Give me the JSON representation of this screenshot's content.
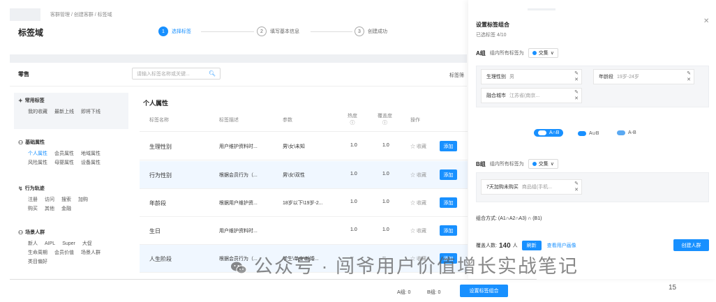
{
  "breadcrumb": "客群管理 / 创建客群 / 标签域",
  "page_title": "标签域",
  "steps": [
    {
      "num": "1",
      "label": "选择标签"
    },
    {
      "num": "2",
      "label": "填写基本信息"
    },
    {
      "num": "3",
      "label": "创建成功"
    }
  ],
  "section_label": "零售",
  "search": {
    "placeholder": "请输入标签名称或关键..."
  },
  "top_right_label": "标签筛",
  "sidebar": {
    "common": {
      "title": "常用标签",
      "items": [
        "我的收藏",
        "最新上线",
        "即将下线"
      ]
    },
    "basic": {
      "title": "基础属性",
      "row1": [
        "个人属性",
        "会员属性",
        "地域属性"
      ],
      "row2": [
        "风险属性",
        "母婴属性",
        "设备属性"
      ]
    },
    "behavior": {
      "title": "行为轨迹",
      "row1": [
        "注册",
        "访问",
        "搜索",
        "加购"
      ],
      "row2": [
        "购买",
        "其他",
        "金融"
      ]
    },
    "scene": {
      "title": "场景人群",
      "row1": [
        "新人",
        "AIPL",
        "Super",
        "大促"
      ],
      "row2": [
        "生命周期",
        "会员价值",
        "场景人群"
      ],
      "row3": [
        "类目偏好"
      ]
    }
  },
  "table": {
    "title": "个人属性",
    "headers": [
      "标签名称",
      "标签描述",
      "参数",
      "热度",
      "覆盖度",
      "操作"
    ],
    "rows": [
      {
        "name": "生理性别",
        "desc": "用户维护资料时...",
        "param": "男\\女\\未知",
        "heat": "1.0",
        "cover": "1.0",
        "fav": "☆ 收藏",
        "add": "添加"
      },
      {
        "name": "行为性别",
        "desc": "根据会员行为（...",
        "param": "男\\女\\双性",
        "heat": "1.0",
        "cover": "1.0",
        "fav": "☆ 收藏",
        "add": "添加"
      },
      {
        "name": "年龄段",
        "desc": "根据用户维护资...",
        "param": "18岁以下\\19岁-2...",
        "heat": "1.0",
        "cover": "1.0",
        "fav": "☆ 收藏",
        "add": "添加"
      },
      {
        "name": "生日",
        "desc": "用户维护资料时...",
        "param": "",
        "heat": "1.0",
        "cover": "1.0",
        "fav": "☆ 收藏",
        "add": "添加"
      },
      {
        "name": "人生阶段",
        "desc": "根据会员行为（...",
        "param": "学生\\单身\\新婚...",
        "heat": "--",
        "cover": "--",
        "fav": "☆ 收藏",
        "add": "添加"
      }
    ]
  },
  "bottom": {
    "count_a": "A组: 0",
    "count_b": "B组: 0",
    "set_combo": "设置标签组合"
  },
  "drawer": {
    "title": "设置标签组合",
    "subtitle": "已选标签 4/10",
    "group_a": {
      "label": "A组",
      "hint": "组内所有标签为",
      "op": "交集",
      "tags": [
        {
          "name": "生理性别",
          "value": "男"
        },
        {
          "name": "年龄段",
          "value": "19岁-24岁"
        },
        {
          "name": "融合城市",
          "value": "江苏省(南京..."
        }
      ]
    },
    "ops": [
      "A∩B",
      "A∪B",
      "A-B"
    ],
    "group_b": {
      "label": "B组",
      "hint": "组内所有标签为",
      "op": "交集",
      "tags": [
        {
          "name": "7天加购未购买",
          "value": "商品组(手机..."
        }
      ]
    },
    "combo_mode": "组合方式: (A1∩A2∩A3) ∩ (B1)",
    "cover_prefix": "覆盖人数:",
    "cover_count": "140",
    "cover_unit": "人",
    "refresh": "刷新",
    "profile_link": "查看用户画像",
    "create_button": "创建人群"
  },
  "watermark": "公众号 · 闯爷用户价值增长实战笔记",
  "page_number": "15",
  "colors": {
    "accent": "#1890ff"
  }
}
